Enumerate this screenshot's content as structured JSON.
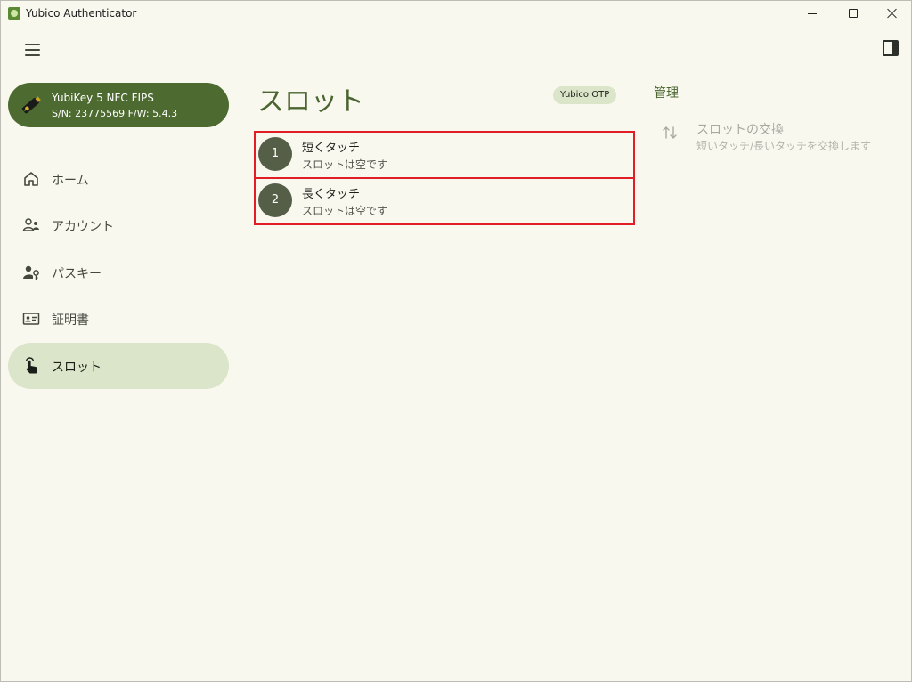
{
  "window": {
    "title": "Yubico Authenticator"
  },
  "device": {
    "name": "YubiKey 5 NFC FIPS",
    "serial_firmware": "S/N: 23775569 F/W: 5.4.3"
  },
  "nav": {
    "items": [
      {
        "label": "ホーム",
        "icon": "home-icon"
      },
      {
        "label": "アカウント",
        "icon": "accounts-icon"
      },
      {
        "label": "パスキー",
        "icon": "passkey-icon"
      },
      {
        "label": "証明書",
        "icon": "certificate-icon"
      },
      {
        "label": "スロット",
        "icon": "touch-icon",
        "active": true
      }
    ]
  },
  "main": {
    "title": "スロット",
    "protocol_chip": "Yubico OTP",
    "slots": [
      {
        "number": "1",
        "name": "短くタッチ",
        "status": "スロットは空です"
      },
      {
        "number": "2",
        "name": "長くタッチ",
        "status": "スロットは空です"
      }
    ]
  },
  "actions": {
    "heading": "管理",
    "swap": {
      "title": "スロットの交換",
      "description": "短いタッチ/長いタッチを交換します"
    }
  },
  "colors": {
    "accent": "#4b6530",
    "active_nav": "#dbe5c9",
    "highlight_border": "#e11d25",
    "background": "#f8f8ef"
  }
}
